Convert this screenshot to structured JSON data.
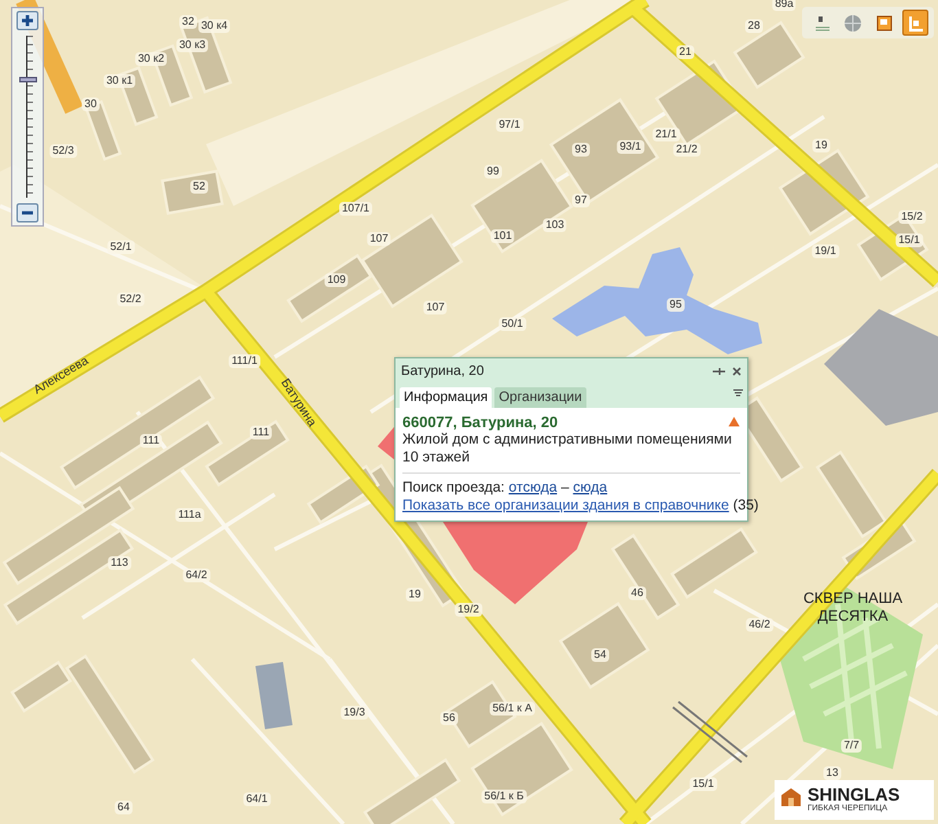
{
  "zoom_control": {
    "level": 0.73
  },
  "toolbar": {
    "tools": [
      {
        "selected": false
      },
      {
        "selected": false
      },
      {
        "selected": false
      },
      {
        "selected": true
      }
    ]
  },
  "map": {
    "street_labels": [
      "Алексеева",
      "Батурина"
    ],
    "place_label": "СКВЕР НАША ДЕСЯТКА",
    "house_numbers": [
      "32",
      "30 к4",
      "30 к3",
      "30 к2",
      "30 к1",
      "30",
      "52/3",
      "52",
      "52/1",
      "52/2",
      "111/1",
      "89а",
      "28",
      "21",
      "97/1",
      "93",
      "93/1",
      "21/1",
      "21/2",
      "19",
      "107/1",
      "99",
      "97",
      "103",
      "107",
      "101",
      "109",
      "107",
      "50/1",
      "95",
      "15/2",
      "19/1",
      "15/1",
      "111",
      "111",
      "111а",
      "113",
      "64/2",
      "19",
      "19/2",
      "46",
      "46/2",
      "54",
      "19/3",
      "56/1 к А",
      "56",
      "64/1",
      "64",
      "56/1 к Б",
      "15/1",
      "7/7",
      "13"
    ]
  },
  "popup": {
    "title": "Батурина, 20",
    "tabs": [
      {
        "label": "Информация",
        "selected": true
      },
      {
        "label": "Организации",
        "selected": false
      }
    ],
    "heading": "660077, Батурина, 20",
    "description": "Жилой дом с административными помещениями",
    "floors": "10 этажей",
    "route_label": "Поиск проезда:",
    "route_from": "отсюда",
    "route_separator": "–",
    "route_to": "сюда",
    "directory_link": "Показать все организации здания в справочнике",
    "directory_count": "(35)"
  },
  "ad": {
    "brand": "SHINGLAS",
    "tagline": "ГИБКАЯ ЧЕРЕПИЦА"
  }
}
